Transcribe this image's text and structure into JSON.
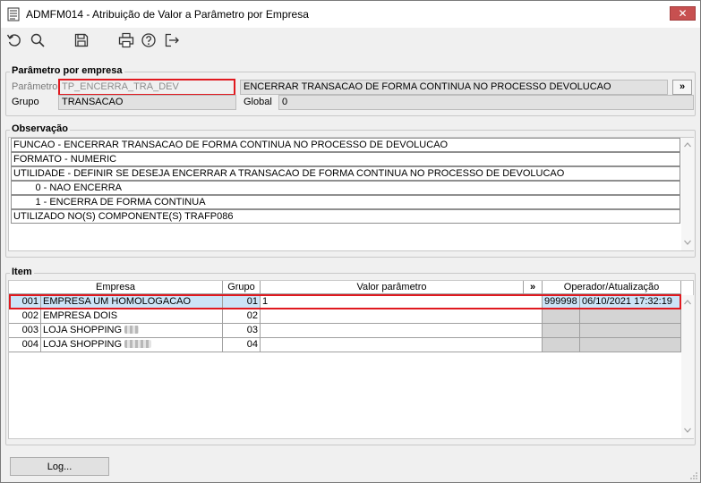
{
  "window": {
    "title": "ADMFM014 - Atribuição de Valor a Parâmetro por Empresa",
    "close_label": "✕"
  },
  "toolbar": {
    "icons": [
      "undo-icon",
      "search-icon",
      "save-icon",
      "print-icon",
      "help-icon",
      "exit-icon"
    ]
  },
  "parametro_group": {
    "legend": "Parâmetro por empresa",
    "parametro_label": "Parâmetro",
    "parametro_value": "TP_ENCERRA_TRA_DEV",
    "descricao_value": "ENCERRAR TRANSACAO DE FORMA CONTINUA NO PROCESSO DEVOLUCAO",
    "more_label": "»",
    "grupo_label": "Grupo",
    "grupo_value": "TRANSACAO",
    "global_label": "Global",
    "global_value": "0"
  },
  "observacao": {
    "legend": "Observação",
    "lines": [
      "FUNCAO - ENCERRAR TRANSACAO DE FORMA CONTINUA NO PROCESSO DE DEVOLUCAO",
      "FORMATO - NUMERIC",
      "UTILIDADE - DEFINIR SE DESEJA ENCERRAR A TRANSACAO DE FORMA CONTINUA NO PROCESSO DE DEVOLUCAO",
      "        0 - NAO ENCERRA",
      "        1 - ENCERRA DE FORMA CONTINUA",
      "UTILIZADO NO(S) COMPONENTE(S) TRAFP086"
    ]
  },
  "item": {
    "legend": "Item",
    "headers": {
      "empresa": "Empresa",
      "grupo": "Grupo",
      "valor": "Valor parâmetro",
      "more": "»",
      "operador": "Operador/Atualização"
    },
    "rows": [
      {
        "code": "001",
        "empresa": "EMPRESA UM HOMOLOGACAO",
        "grupo": "01",
        "valor": "1",
        "operador": "999998",
        "atualizacao": "06/10/2021 17:32:19"
      },
      {
        "code": "002",
        "empresa": "EMPRESA DOIS",
        "grupo": "02",
        "valor": "",
        "operador": "",
        "atualizacao": ""
      },
      {
        "code": "003",
        "empresa": "LOJA SHOPPING",
        "grupo": "03",
        "valor": "",
        "operador": "",
        "atualizacao": ""
      },
      {
        "code": "004",
        "empresa": "LOJA SHOPPING",
        "grupo": "04",
        "valor": "",
        "operador": "",
        "atualizacao": ""
      }
    ]
  },
  "footer": {
    "log_label": "Log..."
  }
}
